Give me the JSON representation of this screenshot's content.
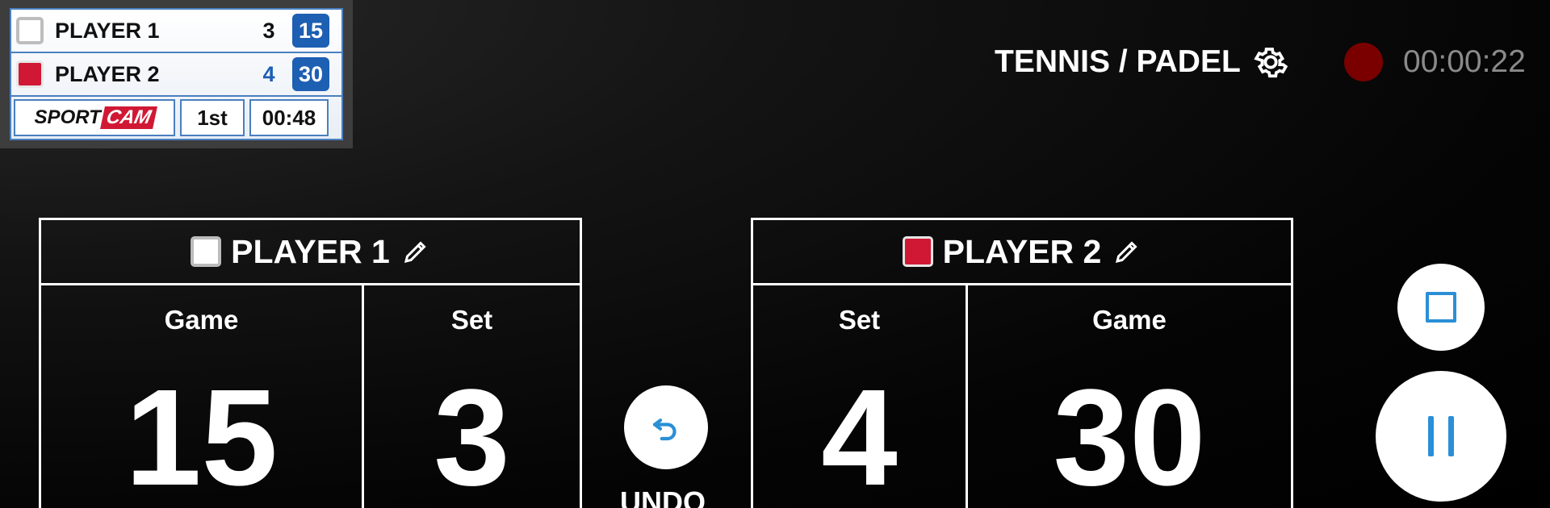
{
  "overlay": {
    "player1": {
      "name": "PLAYER 1",
      "set": "3",
      "game": "15"
    },
    "player2": {
      "name": "PLAYER 2",
      "set": "4",
      "game": "30"
    },
    "logo_sport": "SPORT",
    "logo_cam": "CAM",
    "period": "1st",
    "clock": "00:48"
  },
  "header": {
    "mode_label": "TENNIS / PADEL",
    "recording_time": "00:00:22"
  },
  "panel1": {
    "player_name": "PLAYER 1",
    "game_label": "Game",
    "game_value": "15",
    "set_label": "Set",
    "set_value": "3"
  },
  "panel2": {
    "player_name": "PLAYER 2",
    "set_label": "Set",
    "set_value": "4",
    "game_label": "Game",
    "game_value": "30"
  },
  "undo": {
    "label": "UNDO"
  },
  "colors": {
    "player1": "#ffffff",
    "player2": "#d01835",
    "accent": "#2a8fd6",
    "overlay_blue": "#1d5fb2",
    "recording": "#7a0000"
  }
}
